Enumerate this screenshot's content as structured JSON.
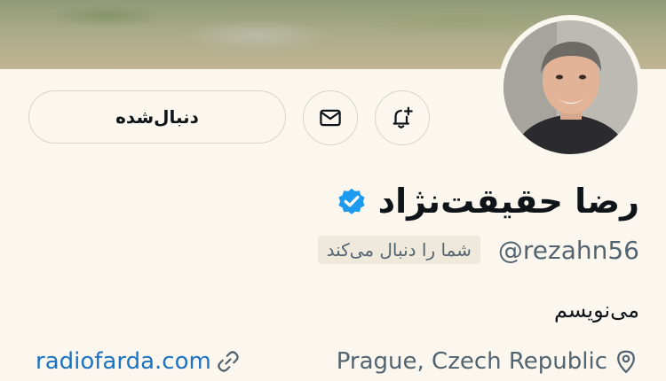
{
  "profile": {
    "display_name": "رضا حقیقت‌نژاد",
    "handle": "@rezahn56",
    "follows_you": "شما را دنبال می‌کند",
    "bio": "می‌نویسم",
    "location": "Prague, Czech Republic",
    "website": "radiofarda.com",
    "verified_color": "#1d9bf0"
  },
  "actions": {
    "following_label": "دنبال‌شده",
    "message_icon": "mail-icon",
    "notify_icon": "bell-plus-icon"
  },
  "colors": {
    "background": "#fbf7ee",
    "link": "#1d73c2",
    "muted": "#536471"
  }
}
